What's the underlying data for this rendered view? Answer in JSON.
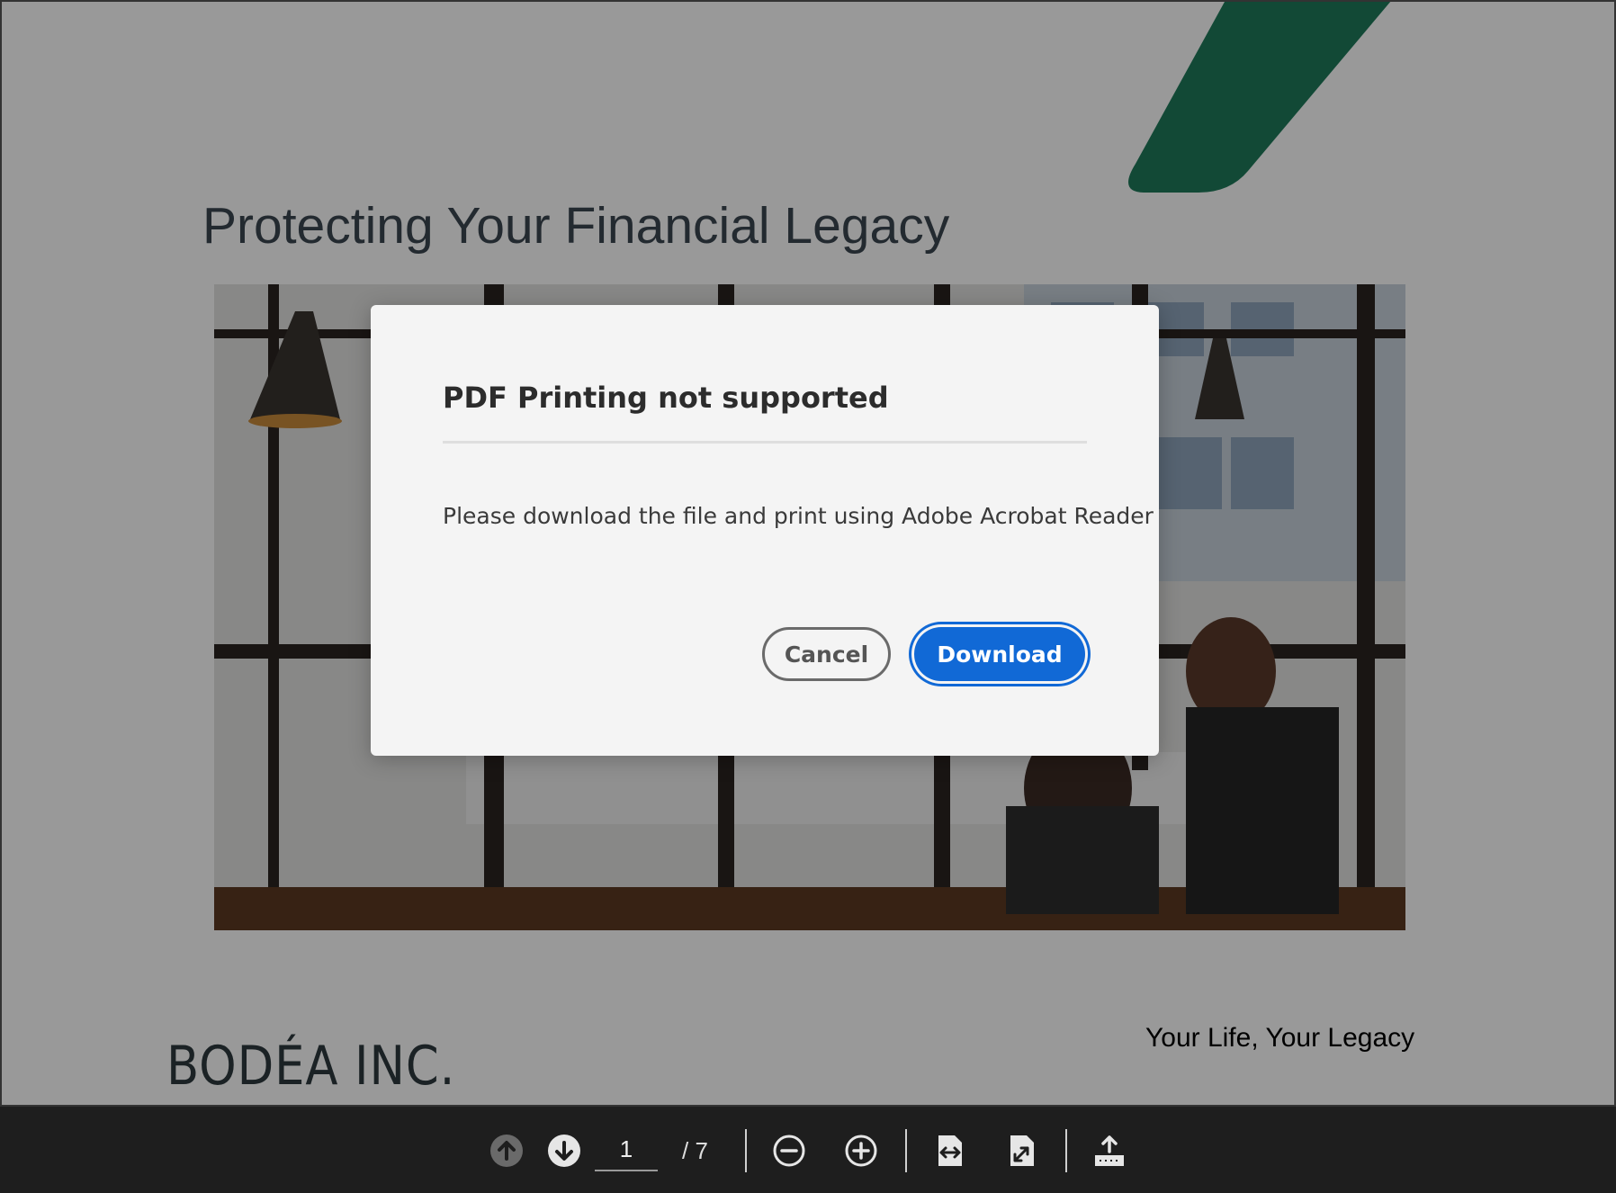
{
  "slide": {
    "title": "Protecting Your Financial Legacy",
    "tagline": "Your Life, Your Legacy",
    "logo_text": "BODÉA INC.",
    "accent_color": "#1e7a5a"
  },
  "dialog": {
    "title": "PDF Printing not supported",
    "message": "Please download the file and print using Adobe Acrobat Reader",
    "cancel_label": "Cancel",
    "download_label": "Download",
    "primary_color": "#1169d6"
  },
  "toolbar": {
    "current_page": "1",
    "page_total": "/ 7",
    "icons": [
      "previous-page-icon",
      "next-page-icon",
      "zoom-out-icon",
      "zoom-in-icon",
      "fit-width-icon",
      "fit-page-icon",
      "print-icon"
    ]
  }
}
